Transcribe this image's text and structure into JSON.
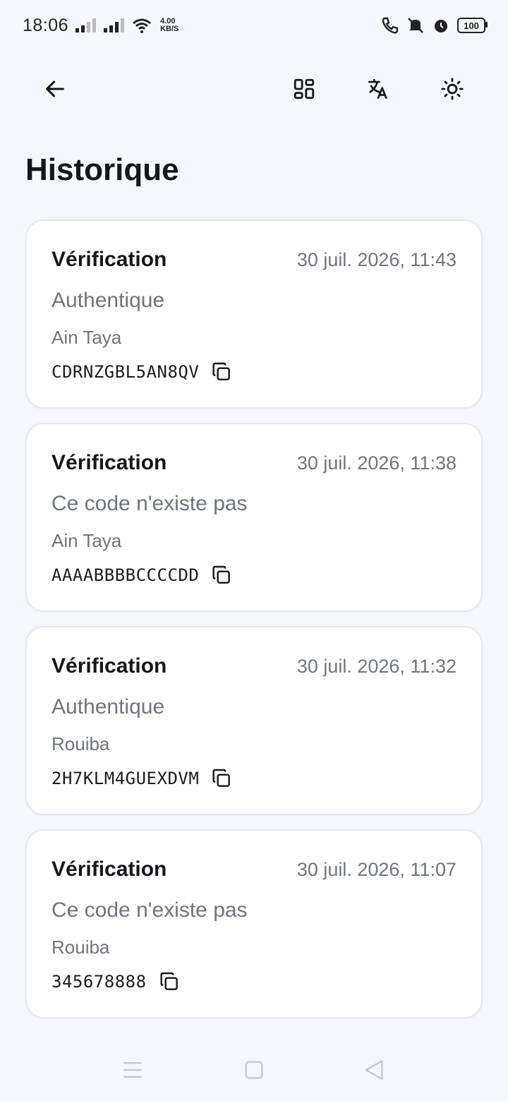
{
  "status_bar": {
    "time": "18:06",
    "net_speed_value": "4.00",
    "net_speed_unit": "KB/S",
    "battery": "100"
  },
  "icons": {
    "back": "arrow-left-icon",
    "scan": "grid-icon",
    "translate": "translate-icon",
    "theme": "sun-icon"
  },
  "page": {
    "title": "Historique"
  },
  "history": [
    {
      "type": "Vérification",
      "date": "30 juil. 2026, 11:43",
      "status": "Authentique",
      "location": "Ain Taya",
      "code": "CDRNZGBL5AN8QV"
    },
    {
      "type": "Vérification",
      "date": "30 juil. 2026, 11:38",
      "status": "Ce code n'existe pas",
      "location": "Ain Taya",
      "code": "AAAABBBBCCCCDD"
    },
    {
      "type": "Vérification",
      "date": "30 juil. 2026, 11:32",
      "status": "Authentique",
      "location": "Rouiba",
      "code": "2H7KLM4GUEXDVM"
    },
    {
      "type": "Vérification",
      "date": "30 juil. 2026, 11:07",
      "status": "Ce code n'existe pas",
      "location": "Rouiba",
      "code": "345678888"
    }
  ],
  "colors": {
    "background": "#f5f7fb",
    "card": "#ffffff",
    "text_primary": "#15171c",
    "text_secondary": "#6f7480"
  }
}
